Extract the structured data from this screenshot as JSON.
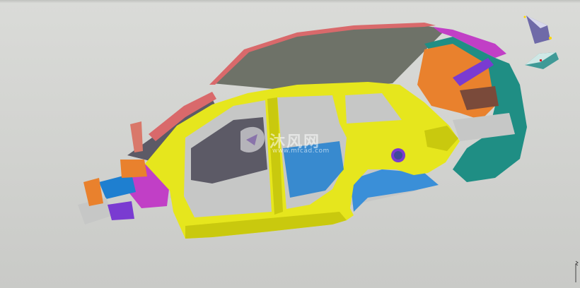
{
  "watermark": {
    "brand_text": "沐风网",
    "url_text": "www.mfcad.com"
  },
  "viewport": {
    "background_color": "#d4d5d2"
  },
  "model": {
    "colors": {
      "side_panel": "#e6e61d",
      "side_panel_shade": "#c9c90e",
      "roof": "#6e7268",
      "roof_rail": "#d9696b",
      "rear_structure": "#1f8e84",
      "front_rails": "#c13fc6",
      "floor_panels": "#c6c7c6",
      "inner_grey": "#6f6b7c",
      "blue_parts": "#1e7fd0",
      "orange_parts": "#e9812d",
      "salmon_parts": "#d9786a",
      "green_parts": "#1fbf2a",
      "purple_parts": "#7a3bd1",
      "teal_floor": "#27a69b"
    }
  },
  "view_triad": {
    "icon": "view-cube-icon",
    "top_color": "#6f6aa8",
    "base_color": "#3f9a97"
  }
}
